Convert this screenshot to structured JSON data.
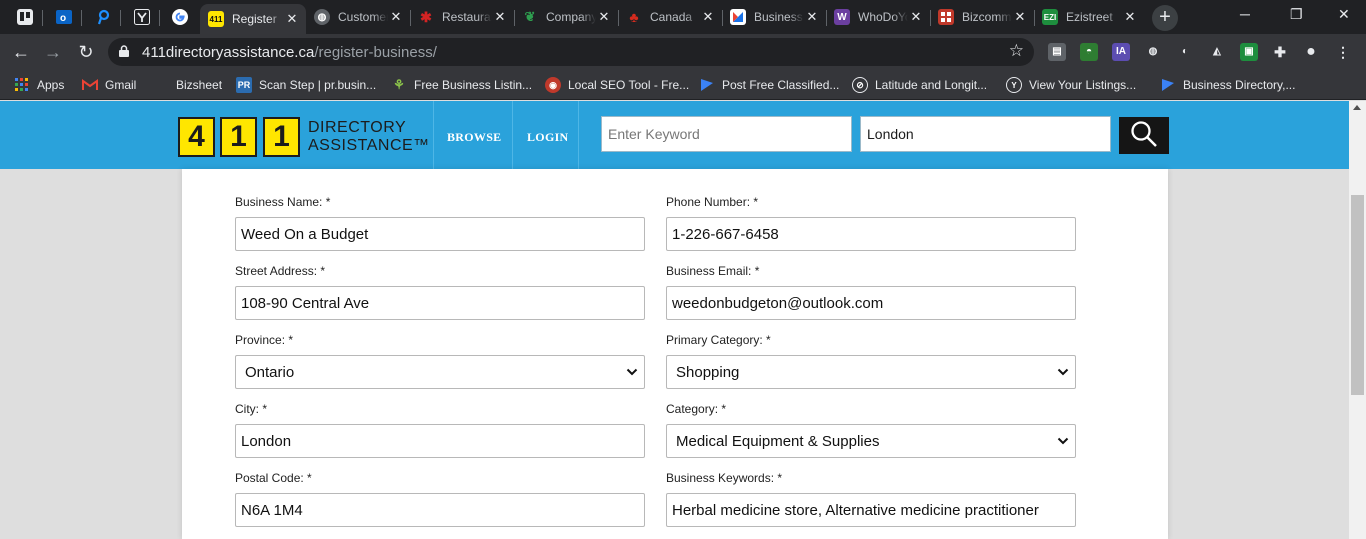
{
  "browser": {
    "pinned_tabs": [
      {
        "icon": "trello-icon",
        "color": "#0079bf"
      },
      {
        "icon": "outlook-icon",
        "color": "#0a64c6"
      },
      {
        "icon": "pressreader-icon",
        "color": "#1e90ff"
      },
      {
        "icon": "yext-icon",
        "color": "#e8eaed"
      },
      {
        "icon": "google-icon",
        "color": "#ffffff"
      }
    ],
    "tabs": [
      {
        "title": "Register",
        "icon": "411-icon",
        "color": "#ffe600",
        "active": true
      },
      {
        "title": "Customer",
        "icon": "globe-icon",
        "color": "#5f6368",
        "active": false
      },
      {
        "title": "Restaurants",
        "icon": "yelp-icon",
        "color": "#d32323",
        "active": false
      },
      {
        "title": "Company",
        "icon": "leaf-icon",
        "color": "#2e9e4f",
        "active": false
      },
      {
        "title": "Canada",
        "icon": "maple-leaf-icon",
        "color": "#d52b1e",
        "active": false
      },
      {
        "title": "Business",
        "icon": "bing-places-icon",
        "color": "#ffffff",
        "active": false
      },
      {
        "title": "WhoDoYou",
        "icon": "whodoyou-icon",
        "color": "#6b3fa0",
        "active": false
      },
      {
        "title": "Bizcommunity",
        "icon": "bizcommunity-icon",
        "color": "#c0392b",
        "active": false
      },
      {
        "title": "Ezistreet",
        "icon": "ezi-icon",
        "color": "#1e8e3e",
        "active": false
      }
    ],
    "new_tab_label": "+",
    "url_host": "411directoryassistance.ca",
    "url_path": "/register-business/",
    "bookmarks": [
      {
        "label": "Apps",
        "icon": "apps-grid-icon",
        "color": "#e8eaed"
      },
      {
        "label": "Gmail",
        "icon": "gmail-icon",
        "color": "#ea4335"
      },
      {
        "label": "Bizsheet",
        "icon": "",
        "color": ""
      },
      {
        "label": "Scan Step | pr.busin...",
        "icon": "pr-icon",
        "color": "#2b6cb0"
      },
      {
        "label": "Free Business Listin...",
        "icon": "plant-icon",
        "color": "#5c8a2e"
      },
      {
        "label": "Local SEO Tool - Fre...",
        "icon": "brain-icon",
        "color": "#c0392b"
      },
      {
        "label": "Post Free Classified...",
        "icon": "flag-icon",
        "color": "#3b82f6"
      },
      {
        "label": "Latitude and Longit...",
        "icon": "compass-icon",
        "color": "#9aa0a6"
      },
      {
        "label": "View Your Listings...",
        "icon": "yext-circle-icon",
        "color": "#9aa0a6"
      },
      {
        "label": "Business Directory,...",
        "icon": "flag-icon",
        "color": "#3b82f6"
      }
    ]
  },
  "site": {
    "logo_digits": [
      "4",
      "1",
      "1"
    ],
    "logo_line1": "DIRECTORY",
    "logo_line2": "ASSISTANCE™",
    "nav": {
      "browse": "BROWSE",
      "login": "LOGIN"
    },
    "search": {
      "keyword_placeholder": "Enter Keyword",
      "location_value": "London"
    },
    "colors": {
      "header": "#2aa2db",
      "logo_yellow": "#ffe600"
    }
  },
  "form": {
    "business_name": {
      "label": "Business Name: *",
      "value": "Weed On a Budget"
    },
    "phone_number": {
      "label": "Phone Number: *",
      "value": "1-226-667-6458"
    },
    "street_address": {
      "label": "Street Address: *",
      "value": "108-90 Central Ave"
    },
    "business_email": {
      "label": "Business Email: *",
      "value": "weedonbudgeton@outlook.com"
    },
    "province": {
      "label": "Province: *",
      "value": "Ontario"
    },
    "primary_category": {
      "label": "Primary Category: *",
      "value": "Shopping"
    },
    "city": {
      "label": "City: *",
      "value": "London"
    },
    "category": {
      "label": "Category: *",
      "value": "Medical Equipment & Supplies"
    },
    "postal_code": {
      "label": "Postal Code: *",
      "value": "N6A 1M4"
    },
    "business_keywords": {
      "label": "Business Keywords: *",
      "value": "Herbal medicine store, Alternative medicine practitioner"
    }
  }
}
